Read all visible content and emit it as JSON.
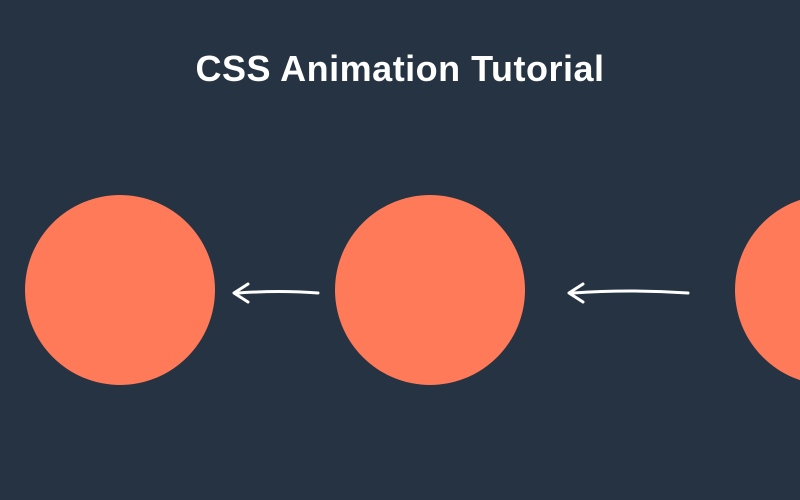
{
  "title": "CSS Animation Tutorial",
  "colors": {
    "background": "#253342",
    "circle": "#ff7a59",
    "text": "#ffffff",
    "arrow": "#ffffff"
  },
  "circles": [
    {
      "name": "circle-1"
    },
    {
      "name": "circle-2"
    },
    {
      "name": "circle-3"
    }
  ],
  "arrows": [
    {
      "name": "arrow-1",
      "direction": "left"
    },
    {
      "name": "arrow-2",
      "direction": "left"
    }
  ]
}
